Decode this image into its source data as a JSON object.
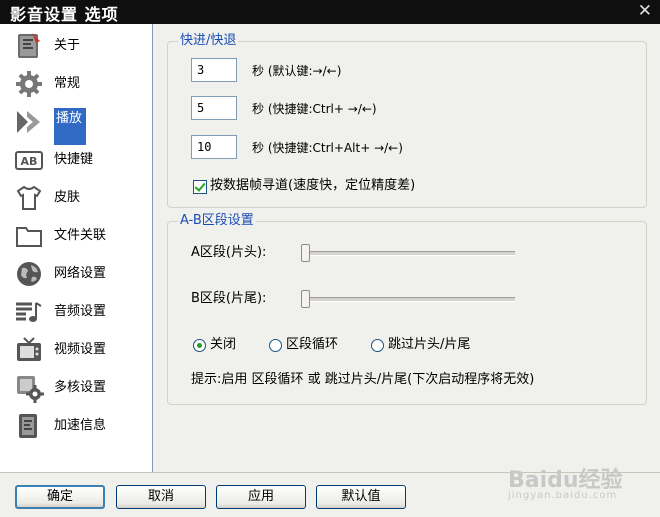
{
  "window": {
    "title": "影音设置 选项"
  },
  "sidebar": {
    "items": [
      {
        "label": "关于",
        "icon": "about-book-icon"
      },
      {
        "label": "常规",
        "icon": "gear-icon"
      },
      {
        "label": "播放",
        "icon": "play-arrows-icon",
        "selected": true
      },
      {
        "label": "快捷键",
        "icon": "keyboard-ab-icon"
      },
      {
        "label": "皮肤",
        "icon": "tshirt-icon"
      },
      {
        "label": "文件关联",
        "icon": "folder-icon"
      },
      {
        "label": "网络设置",
        "icon": "globe-icon"
      },
      {
        "label": "音频设置",
        "icon": "music-lines-icon"
      },
      {
        "label": "视频设置",
        "icon": "tv-icon"
      },
      {
        "label": "多核设置",
        "icon": "multicore-gear-icon"
      },
      {
        "label": "加速信息",
        "icon": "accel-book-icon"
      }
    ]
  },
  "seek": {
    "legend": "快进/快退",
    "rows": [
      {
        "value": "3",
        "label": "秒 (默认键:→/←)"
      },
      {
        "value": "5",
        "label": "秒 (快捷键:Ctrl+ →/←)"
      },
      {
        "value": "10",
        "label": "秒 (快捷键:Ctrl+Alt+ →/←)"
      }
    ],
    "keyframe_checkbox": {
      "label": "按数据帧寻道(速度快，定位精度差)",
      "checked": true
    }
  },
  "ab": {
    "legend": "A-B区段设置",
    "a_label": "A区段(片头):",
    "b_label": "B区段(片尾):",
    "a_level": 0,
    "b_level": 0,
    "radios": [
      {
        "label": "关闭",
        "checked": true
      },
      {
        "label": "区段循环",
        "checked": false
      },
      {
        "label": "跳过片头/片尾",
        "checked": false
      }
    ],
    "hint": "提示:启用 区段循环 或 跳过片头/片尾(下次启动程序将无效)"
  },
  "footer": {
    "ok": "确定",
    "cancel": "取消",
    "apply": "应用",
    "defaults": "默认值"
  },
  "watermark": {
    "brand": "Baidu经验",
    "url": "jingyan.baidu.com"
  },
  "colors": {
    "selection": "#316ac5",
    "legend": "#1b4eb5",
    "check": "#21a121"
  }
}
